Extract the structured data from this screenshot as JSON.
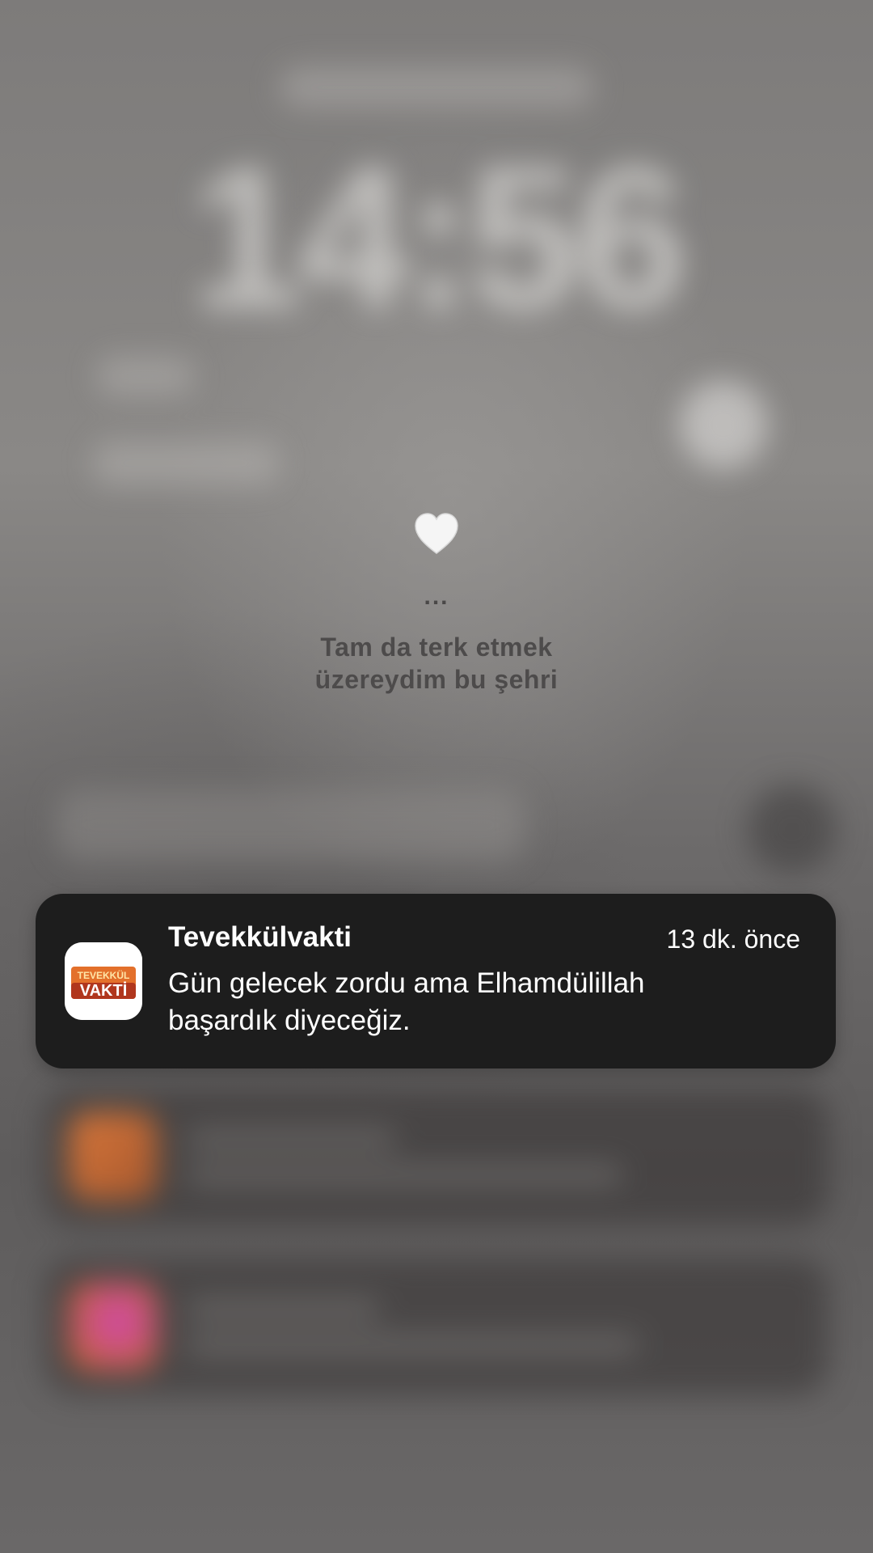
{
  "lockscreen": {
    "clock": "14:56"
  },
  "story": {
    "ellipsis": "...",
    "line1": "Tam da terk etmek",
    "line2": "üzereydim bu şehri"
  },
  "notification": {
    "app_name": "Tevekkülvakti",
    "time": "13 dk. önce",
    "body_line1": "Gün gelecek zordu ama Elhamdülillah",
    "body_line2": "başardık diyeceğiz.",
    "icon": "tevekkulvakti-app-icon",
    "icon_text_top": "TEVEKKÜL",
    "icon_text_bottom": "VAKTİ"
  },
  "colors": {
    "notification_bg": "#1d1d1d",
    "background": "#6f6e6e",
    "heart": "#f5f5f5"
  }
}
